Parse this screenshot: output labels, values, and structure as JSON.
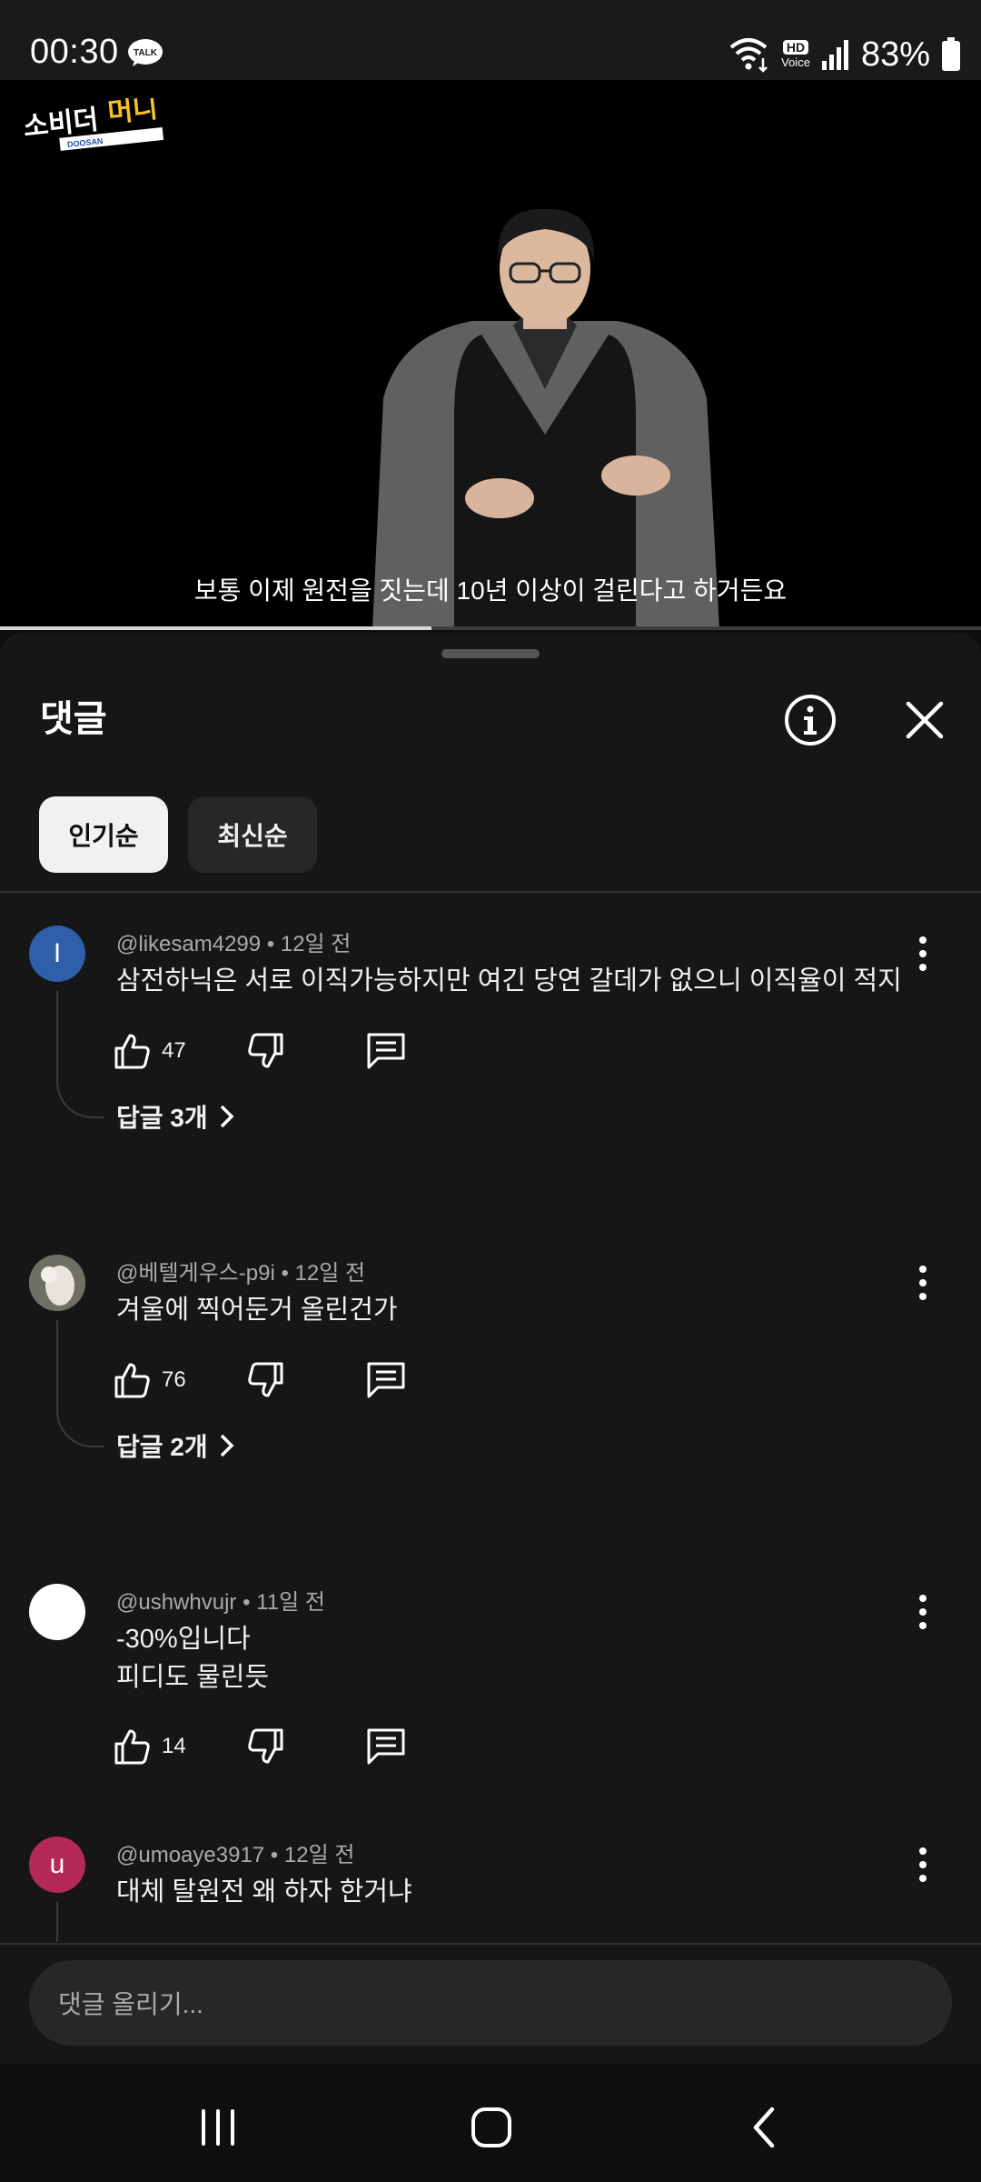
{
  "status_bar": {
    "time": "00:30",
    "talk_badge": "TALK",
    "hd_voice_top": "HD",
    "hd_voice_bottom": "Voice",
    "battery": "83%"
  },
  "video": {
    "logo_text": "소비더머니",
    "logo_subtext": "DOOSAN",
    "subtitle": "보통 이제 원전을 짓는데 10년 이상이 걸린다고 하거든요",
    "progress": 0.44
  },
  "comments_panel": {
    "title": "댓글",
    "sort_chips": [
      "인기순",
      "최신순"
    ],
    "input_placeholder": "댓글 올리기..."
  },
  "comments": [
    {
      "avatar_letter": "I",
      "avatar_color": "#2f5eaa",
      "author": "@likesam4299",
      "age": "12일 전",
      "text": "삼전하닉은 서로 이직가능하지만 여긴 당연 갈데가 없으니 이직율이 적지",
      "likes": "47",
      "replies": "답글 3개"
    },
    {
      "avatar_letter": "",
      "avatar_color": "#8a8a80",
      "author": "@베텔게우스-p9i",
      "age": "12일 전",
      "text": "겨울에 찍어둔거 올린건가",
      "likes": "76",
      "replies": "답글 2개"
    },
    {
      "avatar_letter": "",
      "avatar_color": "#ffffff",
      "author": "@ushwhvujr",
      "age": "11일 전",
      "text_line1": "-30%입니다",
      "text_line2": "피디도 물린듯",
      "likes": "14"
    },
    {
      "avatar_letter": "u",
      "avatar_color": "#b4285a",
      "author": "@umoaye3917",
      "age": "12일 전",
      "text": "대체 탈원전 왜 하자 한거냐"
    }
  ],
  "meta_separator": " • "
}
